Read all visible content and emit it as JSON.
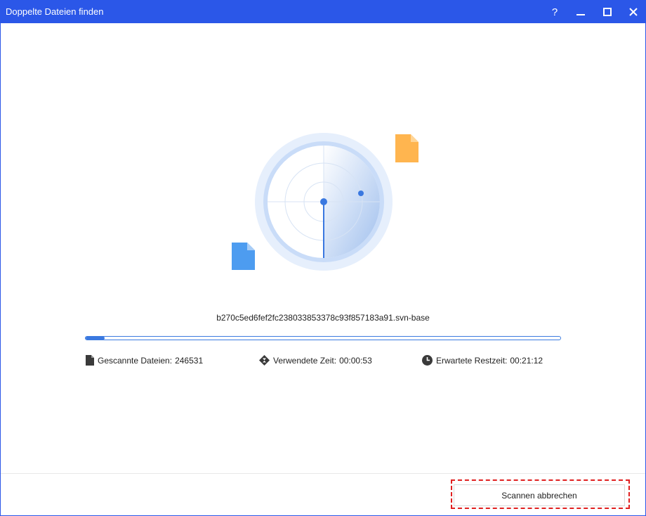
{
  "window": {
    "title": "Doppelte Dateien finden",
    "controls": {
      "help": "?",
      "help_icon": "question-mark-icon",
      "minimize_icon": "minimize-icon",
      "maximize_icon": "maximize-icon",
      "close_icon": "close-icon"
    }
  },
  "scan": {
    "current_file": "b270c5ed6fef2fc238033853378c93f857183a91.svn-base",
    "progress_percent": 4,
    "stats": {
      "scanned_label": "Gescannte Dateien:",
      "scanned_value": "246531",
      "scanned_icon": "file-icon",
      "elapsed_label": "Verwendete Zeit:",
      "elapsed_value": "00:00:53",
      "elapsed_icon": "hourglass-icon",
      "remaining_label": "Erwartete Restzeit:",
      "remaining_value": "00:21:12",
      "remaining_icon": "clock-icon"
    }
  },
  "footer": {
    "cancel_label": "Scannen abbrechen"
  },
  "colors": {
    "titlebar": "#2b57e8",
    "accent": "#3a78e0",
    "file_orange": "#ffb54f",
    "file_blue": "#4d9cf0",
    "highlight": "#e02020"
  }
}
